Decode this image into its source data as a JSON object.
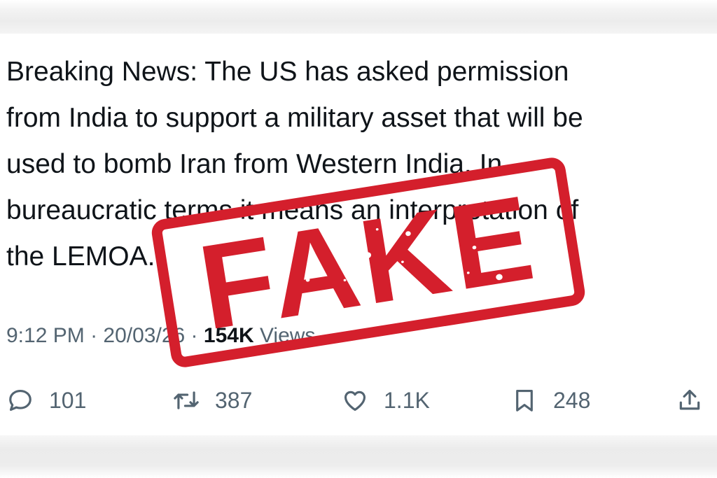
{
  "tweet": {
    "text_lines": [
      "Breaking News: The US has asked permission",
      "from India to support a military asset that will be",
      "used to bomb Iran from Western India. In",
      "bureaucratic terms it means an interpretation of",
      "the LEMOA."
    ],
    "time": "9:12 PM",
    "separator": "·",
    "date": "20/03/26",
    "views_count": "154K",
    "views_label": "Views"
  },
  "actions": {
    "replies": "101",
    "retweets": "387",
    "likes": "1.1K",
    "bookmarks": "248"
  },
  "stamp": {
    "text": "FAKE",
    "color": "#d41f2c"
  },
  "colors": {
    "text": "#0f1419",
    "muted": "#536471"
  },
  "icons": [
    "reply-icon",
    "retweet-icon",
    "like-icon",
    "bookmark-icon",
    "share-icon"
  ]
}
